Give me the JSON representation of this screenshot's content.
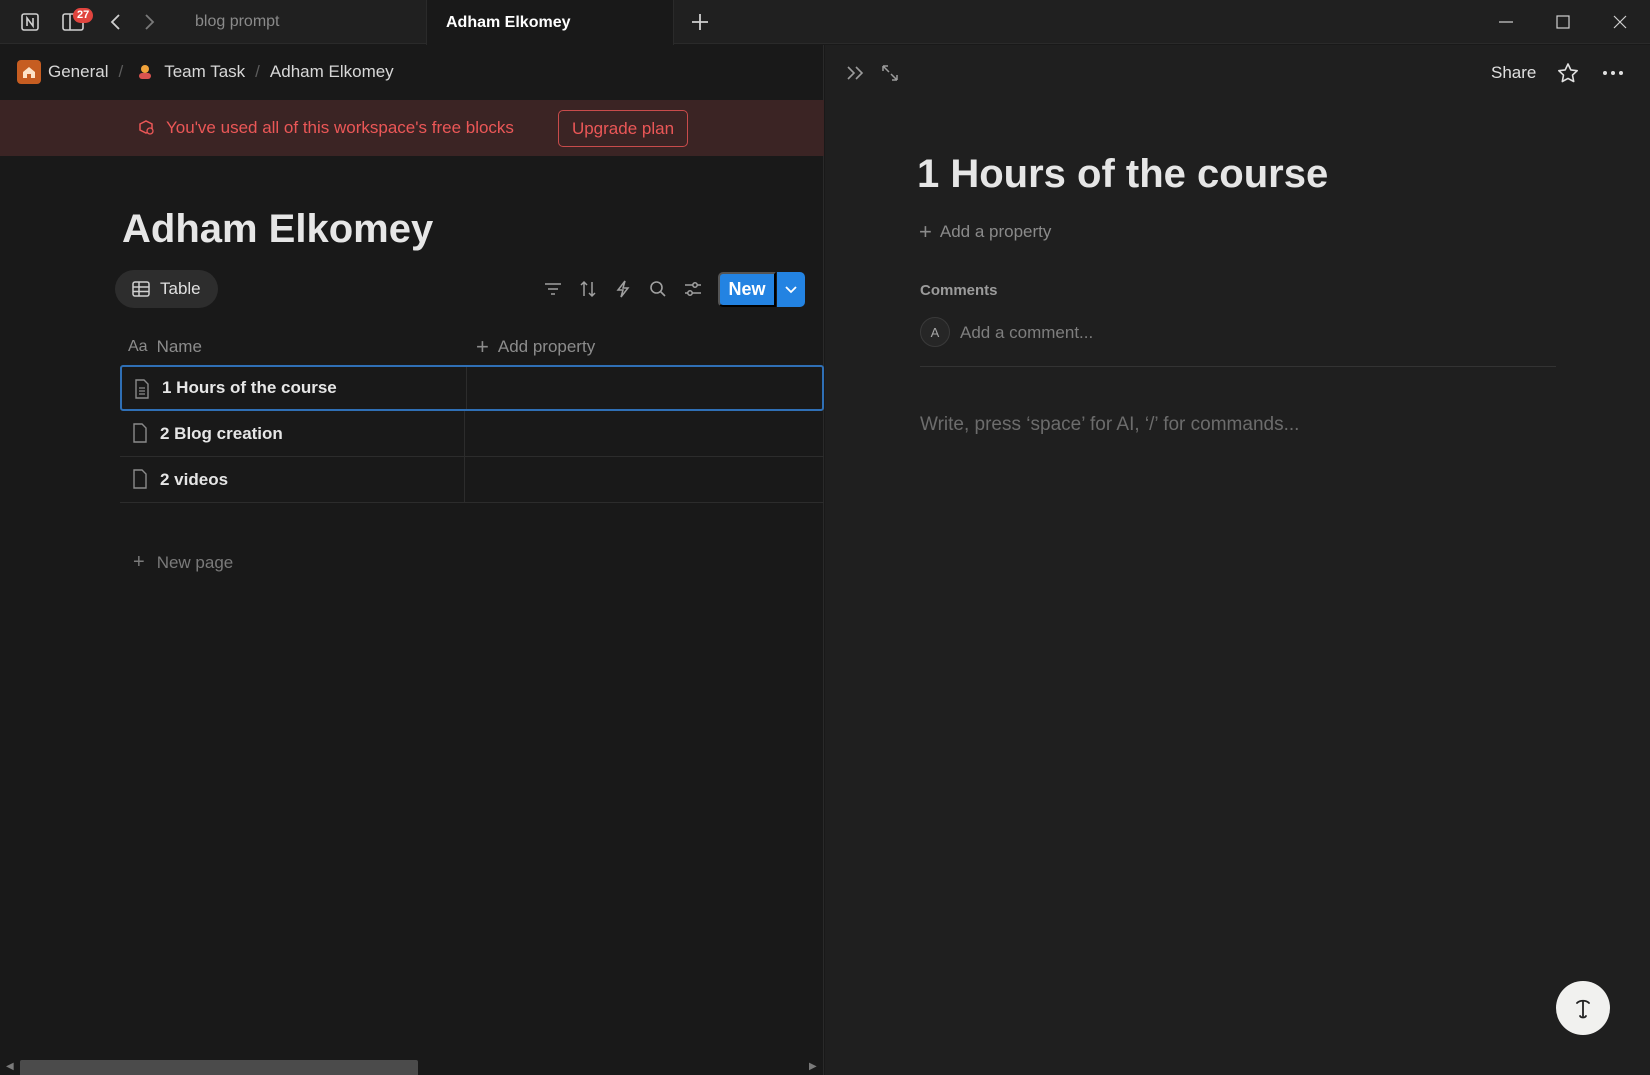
{
  "titlebar": {
    "notification_count": "27",
    "tabs": [
      {
        "label": "blog prompt"
      },
      {
        "label": "Adham Elkomey"
      }
    ]
  },
  "breadcrumb": {
    "items": [
      {
        "label": "General"
      },
      {
        "label": "Team Task"
      },
      {
        "label": "Adham Elkomey"
      }
    ]
  },
  "banner": {
    "message": "You've used all of this workspace's free blocks",
    "upgrade_label": "Upgrade plan"
  },
  "database": {
    "title": "Adham Elkomey",
    "view_label": "Table",
    "new_label": "New",
    "columns": [
      {
        "label": "Name"
      },
      {
        "label": "Add property"
      }
    ],
    "rows": [
      {
        "name": "1 Hours of the course"
      },
      {
        "name": "2 Blog creation"
      },
      {
        "name": "2 videos"
      }
    ],
    "new_page_label": "New page"
  },
  "detail": {
    "share_label": "Share",
    "title": "1 Hours of the course",
    "add_property_label": "Add a property",
    "comments_label": "Comments",
    "avatar_initial": "A",
    "comment_placeholder": "Add a comment...",
    "editor_hint": "Write, press ‘space’ for AI, ‘/’ for commands..."
  },
  "colors": {
    "accent": "#2383e2",
    "warning": "#eb5757",
    "background": "#191919",
    "panel": "#1f1f1f"
  },
  "icons": [
    "notion-logo-icon",
    "sidebar-icon",
    "back-icon",
    "forward-icon",
    "add-tab-icon",
    "minimize-icon",
    "maximize-icon",
    "close-icon",
    "home-icon",
    "team-icon",
    "warning-icon",
    "table-icon",
    "filter-icon",
    "sort-icon",
    "automation-icon",
    "search-icon",
    "settings-icon",
    "chevron-down-icon",
    "text-type-icon",
    "plus-icon",
    "document-icon",
    "collapse-panel-icon",
    "expand-icon",
    "star-icon",
    "more-icon",
    "help-icon"
  ]
}
